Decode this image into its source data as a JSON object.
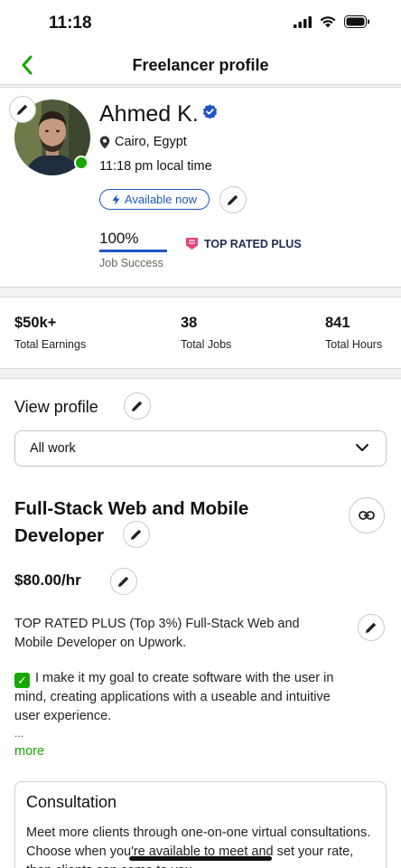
{
  "status": {
    "time": "11:18"
  },
  "nav": {
    "title": "Freelancer profile"
  },
  "profile": {
    "name": "Ahmed K.",
    "location": "Cairo, Egypt",
    "local_time": "11:18 pm local time",
    "available_label": "Available now",
    "job_success_value": "100%",
    "job_success_label": "Job Success",
    "badge": "TOP RATED PLUS"
  },
  "stats": [
    {
      "value": "$50k+",
      "label": "Total Earnings"
    },
    {
      "value": "38",
      "label": "Total Jobs"
    },
    {
      "value": "841",
      "label": "Total Hours"
    }
  ],
  "work": {
    "view_profile_label": "View profile",
    "dropdown_value": "All work",
    "title": "Full-Stack Web and Mobile Developer",
    "rate": "$80.00/hr",
    "description_1": "TOP RATED PLUS (Top 3%) Full-Stack Web and Mobile Developer on Upwork.",
    "description_2": "I make it my goal to create software with the user in mind, creating applications with a useable and intuitive user experience.",
    "ellipsis": "...",
    "more_label": "more"
  },
  "consultation": {
    "title": "Consultation",
    "text": "Meet more clients through one-on-one virtual consultations. Choose when you're available to meet and set your rate, then clients can come to you."
  },
  "colors": {
    "accent_green": "#14a800",
    "accent_blue": "#1f57c3",
    "badge_pink": "#e0457b"
  }
}
